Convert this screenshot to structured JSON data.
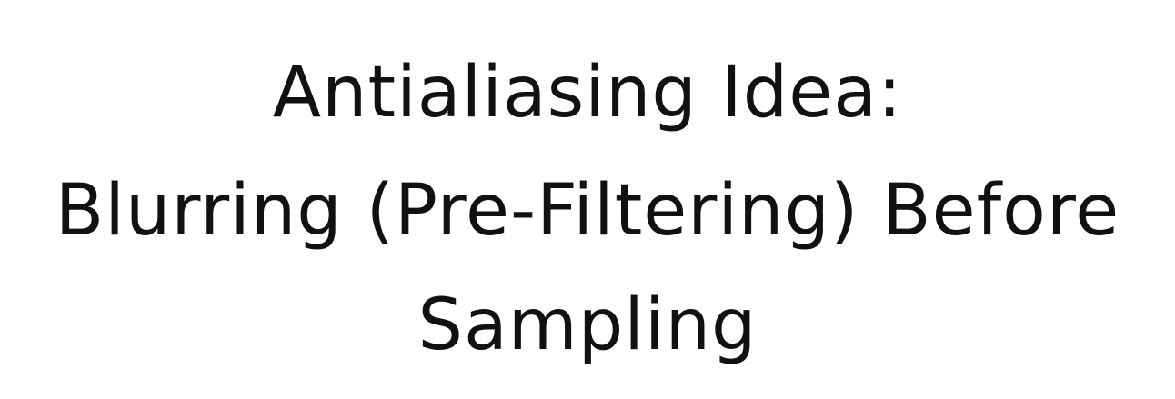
{
  "slide": {
    "title_lines": [
      "Antialiasing Idea:",
      "Blurring (Pre-Filtering) Before",
      "Sampling"
    ]
  }
}
